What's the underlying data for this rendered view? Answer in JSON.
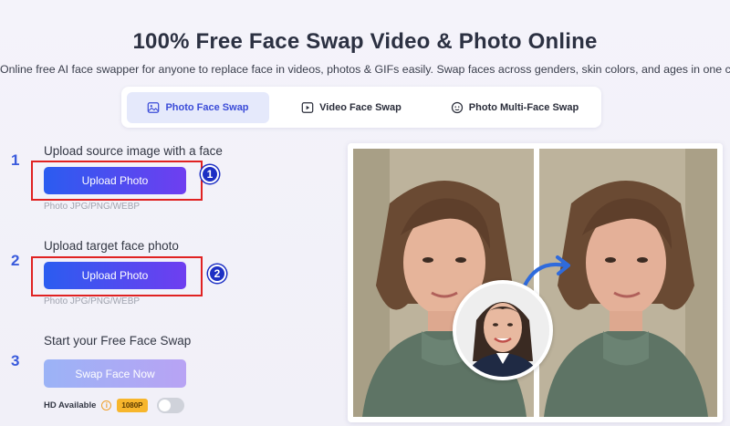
{
  "header": {
    "title": "100% Free Face Swap Video & Photo Online",
    "subtitle": "Online free AI face swapper for anyone to replace face in videos, photos & GIFs easily. Swap faces across genders, skin colors, and ages in one click!"
  },
  "tabs": [
    {
      "label": "Photo Face Swap",
      "icon": "image-icon",
      "active": true
    },
    {
      "label": "Video Face Swap",
      "icon": "video-play-icon",
      "active": false
    },
    {
      "label": "Photo Multi-Face Swap",
      "icon": "multi-face-icon",
      "active": false
    }
  ],
  "steps": [
    {
      "number": "1",
      "title": "Upload source image with a face",
      "button": "Upload Photo",
      "hint": "Photo JPG/PNG/WEBP",
      "badge": "1"
    },
    {
      "number": "2",
      "title": "Upload target face photo",
      "button": "Upload Photo",
      "hint": "Photo JPG/PNG/WEBP",
      "badge": "2"
    },
    {
      "number": "3",
      "title": "Start your Free Face Swap",
      "button": "Swap Face Now"
    }
  ],
  "hd": {
    "label": "HD Available",
    "info_icon": "info-icon",
    "badge": "1080P",
    "toggle_on": false
  },
  "colors": {
    "accent": "#3b4cd8",
    "annotation_red": "#e02222",
    "badge_blue": "#1c2fc4",
    "hd_badge": "#f7b62c"
  }
}
